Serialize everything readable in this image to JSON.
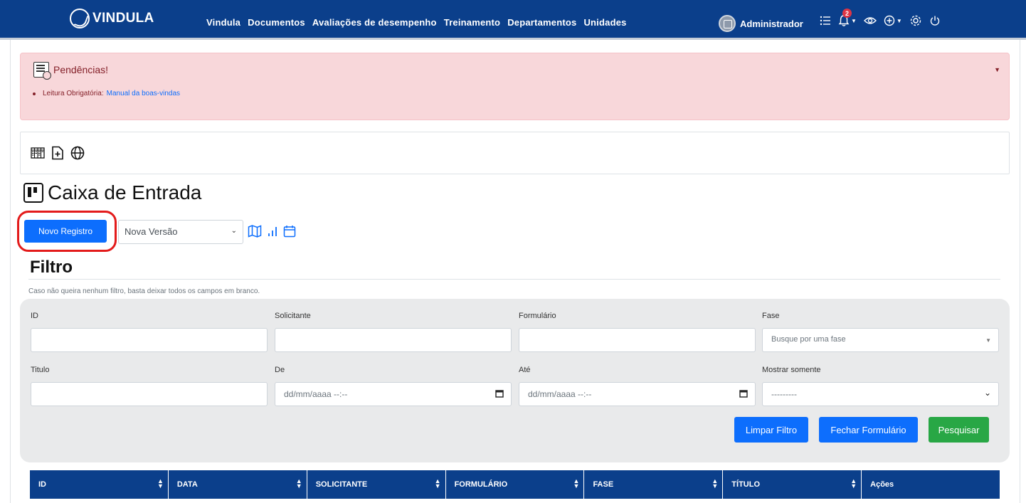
{
  "brand": {
    "name": "VINDULA"
  },
  "nav": {
    "items": [
      "Vindula",
      "Documentos",
      "Avaliações de desempenho",
      "Treinamento",
      "Departamentos",
      "Unidades"
    ]
  },
  "user": {
    "name": "Administrador",
    "notifications": "2"
  },
  "icons": {
    "topbar": [
      "list-icon",
      "bell-icon",
      "eye-icon",
      "plus-circle-icon",
      "gear-icon",
      "power-icon"
    ],
    "toolbar": [
      "columns-icon",
      "file-plus-icon",
      "globe-icon"
    ],
    "action": [
      "map-icon",
      "bar-chart-icon",
      "calendar-icon"
    ]
  },
  "alert": {
    "title": "Pendências!",
    "item_label": "Leitura Obrigatória:",
    "item_link": "Manual da boas-vindas"
  },
  "page": {
    "title": "Caixa de Entrada"
  },
  "actions": {
    "new_button": "Novo Registro",
    "version_select": "Nova Versão"
  },
  "filter": {
    "title": "Filtro",
    "hint": "Caso não queira nenhum filtro, basta deixar todos os campos em branco.",
    "labels": {
      "id": "ID",
      "solicitante": "Solicitante",
      "formulario": "Formulário",
      "fase": "Fase",
      "titulo": "Titulo",
      "de": "De",
      "ate": "Até",
      "mostrar": "Mostrar somente"
    },
    "placeholders": {
      "fase": "Busque por uma fase",
      "de": "dd/mm/aaaa --:--",
      "ate": "dd/mm/aaaa --:--",
      "mostrar": "---------"
    },
    "buttons": {
      "limpar": "Limpar Filtro",
      "fechar": "Fechar Formulário",
      "pesquisar": "Pesquisar"
    }
  },
  "table": {
    "columns": [
      "ID",
      "DATA",
      "SOLICITANTE",
      "FORMULÁRIO",
      "FASE",
      "TÍTULO",
      "Ações"
    ]
  },
  "colors": {
    "primary_nav": "#0b3f8b",
    "primary_button": "#0d6efd",
    "success_button": "#28a745",
    "alert_bg": "#f8d7da",
    "highlight": "#e31b1b"
  }
}
